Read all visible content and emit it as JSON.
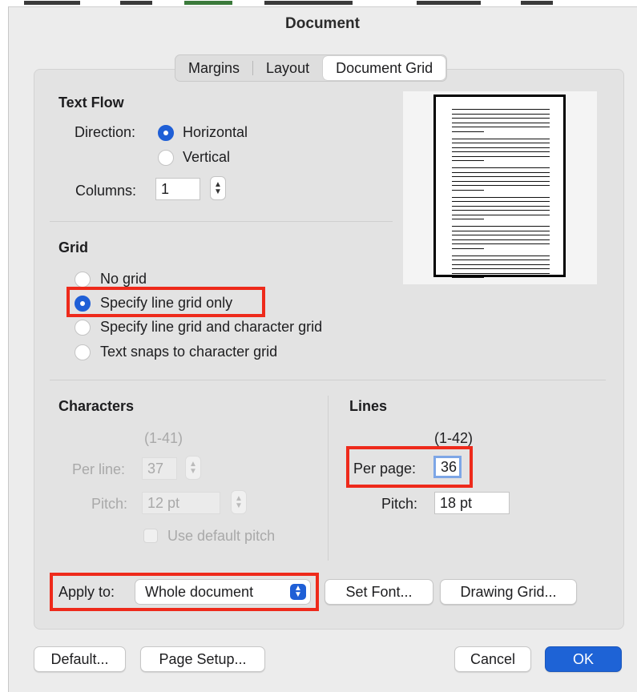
{
  "window": {
    "title": "Document"
  },
  "tabs": [
    {
      "label": "Margins",
      "active": false
    },
    {
      "label": "Layout",
      "active": false
    },
    {
      "label": "Document Grid",
      "active": true
    }
  ],
  "text_flow": {
    "heading": "Text Flow",
    "direction_label": "Direction:",
    "options": [
      {
        "label": "Horizontal",
        "selected": true
      },
      {
        "label": "Vertical",
        "selected": false
      }
    ],
    "columns_label": "Columns:",
    "columns_value": "1"
  },
  "grid": {
    "heading": "Grid",
    "options": [
      {
        "label": "No grid",
        "selected": false
      },
      {
        "label": "Specify line grid only",
        "selected": true
      },
      {
        "label": "Specify line grid and character grid",
        "selected": false
      },
      {
        "label": "Text snaps to character grid",
        "selected": false
      }
    ]
  },
  "characters": {
    "heading": "Characters",
    "range": "(1-41)",
    "per_line_label": "Per line:",
    "per_line_value": "37",
    "pitch_label": "Pitch:",
    "pitch_value": "12 pt",
    "use_default_label": "Use default pitch"
  },
  "lines": {
    "heading": "Lines",
    "range": "(1-42)",
    "per_page_label": "Per page:",
    "per_page_value": "36",
    "pitch_label": "Pitch:",
    "pitch_value": "18 pt"
  },
  "apply": {
    "label": "Apply to:",
    "value": "Whole document"
  },
  "buttons": {
    "set_font": "Set Font...",
    "drawing_grid": "Drawing Grid...",
    "default": "Default...",
    "page_setup": "Page Setup...",
    "cancel": "Cancel",
    "ok": "OK"
  },
  "colors": {
    "accent": "#1f5fd6",
    "highlight": "#ee2a1b"
  }
}
